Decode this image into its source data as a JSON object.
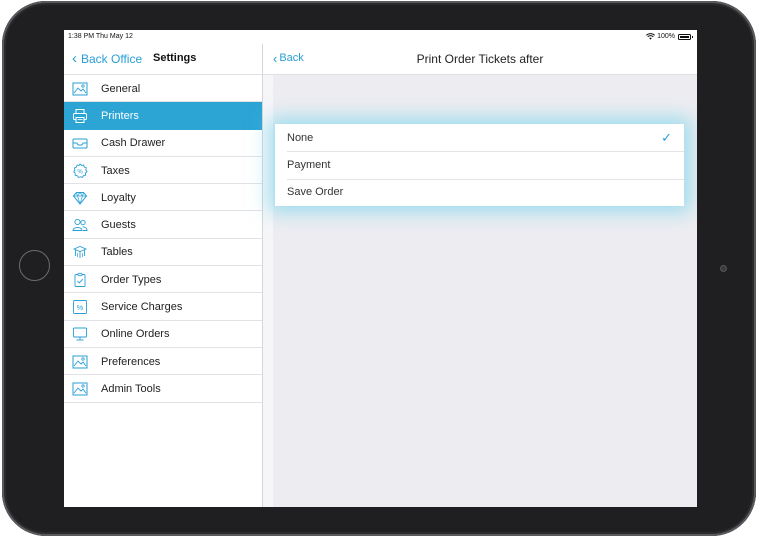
{
  "status": {
    "time": "1:38 PM  Thu May 12",
    "battery": "100%"
  },
  "sidebar": {
    "back_label": "Back Office",
    "title": "Settings",
    "items": [
      {
        "label": "General",
        "icon": "general-icon"
      },
      {
        "label": "Printers",
        "icon": "printer-icon",
        "active": true
      },
      {
        "label": "Cash Drawer",
        "icon": "cash-drawer-icon"
      },
      {
        "label": "Taxes",
        "icon": "tax-icon"
      },
      {
        "label": "Loyalty",
        "icon": "diamond-icon"
      },
      {
        "label": "Guests",
        "icon": "guests-icon"
      },
      {
        "label": "Tables",
        "icon": "table-icon"
      },
      {
        "label": "Order Types",
        "icon": "clipboard-icon"
      },
      {
        "label": "Service Charges",
        "icon": "percent-icon"
      },
      {
        "label": "Online Orders",
        "icon": "monitor-icon"
      },
      {
        "label": "Preferences",
        "icon": "preferences-icon"
      },
      {
        "label": "Admin Tools",
        "icon": "admin-tools-icon"
      }
    ]
  },
  "detail": {
    "back_label": "Back",
    "title": "Print Order Tickets after",
    "options": [
      {
        "label": "None",
        "selected": true
      },
      {
        "label": "Payment",
        "selected": false
      },
      {
        "label": "Save Order",
        "selected": false
      }
    ],
    "check_glyph": "✓"
  },
  "colors": {
    "accent": "#2ca5d5",
    "link": "#2a9fd6",
    "glow": "#5acdeb"
  }
}
